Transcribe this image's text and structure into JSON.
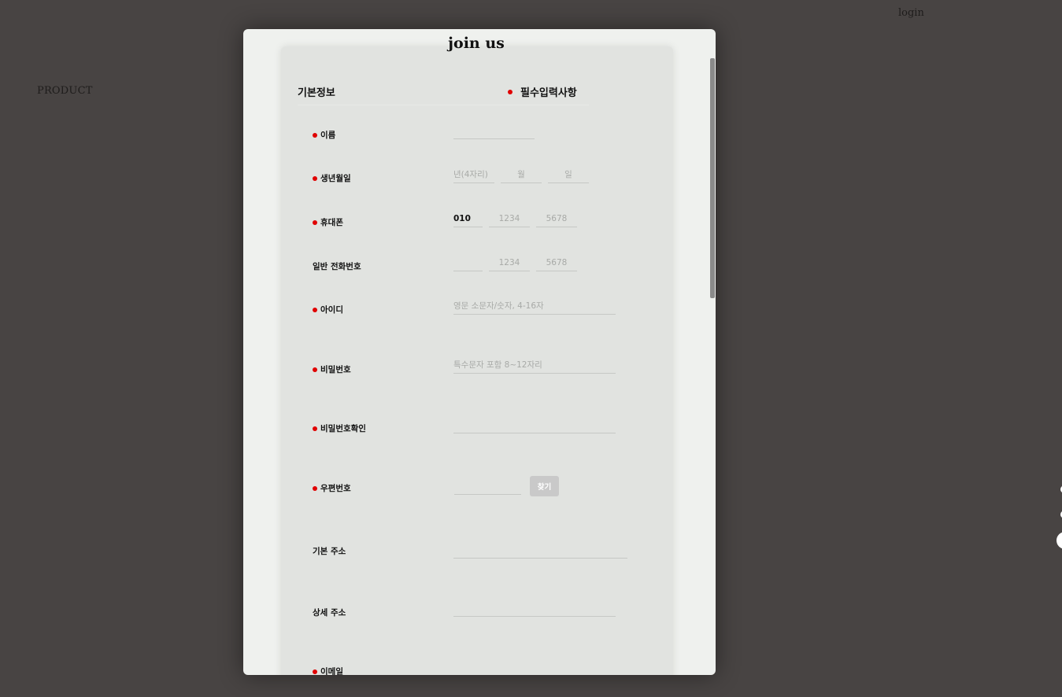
{
  "header": {
    "login_label": "login"
  },
  "nav": {
    "product_label": "PRODUCT"
  },
  "modal": {
    "title": "join us",
    "section_title": "기본정보",
    "required_note": "필수입력사항"
  },
  "form": {
    "name": {
      "label": "이름",
      "value": ""
    },
    "birth": {
      "label": "생년월일",
      "year_placeholder": "년(4자리)",
      "month_placeholder": "월",
      "day_placeholder": "일"
    },
    "mobile": {
      "label": "휴대폰",
      "prefix_value": "010",
      "mid_placeholder": "1234",
      "last_placeholder": "5678"
    },
    "phone": {
      "label": "일반 전화번호",
      "mid_placeholder": "1234",
      "last_placeholder": "5678"
    },
    "userid": {
      "label": "아이디",
      "placeholder": "영문 소문자/숫자, 4-16자"
    },
    "password": {
      "label": "비밀번호",
      "placeholder": "특수문자 포함 8~12자리"
    },
    "password_confirm": {
      "label": "비밀번호확인"
    },
    "zipcode": {
      "label": "우편번호",
      "find_button": "찾기"
    },
    "address1": {
      "label": "기본 주소"
    },
    "address2": {
      "label": "상세 주소"
    },
    "email": {
      "label": "이메일"
    }
  },
  "colors": {
    "background": "#484443",
    "modal": "#eff1ee",
    "panel": "#e1e3e0",
    "required_dot": "#e00000"
  }
}
